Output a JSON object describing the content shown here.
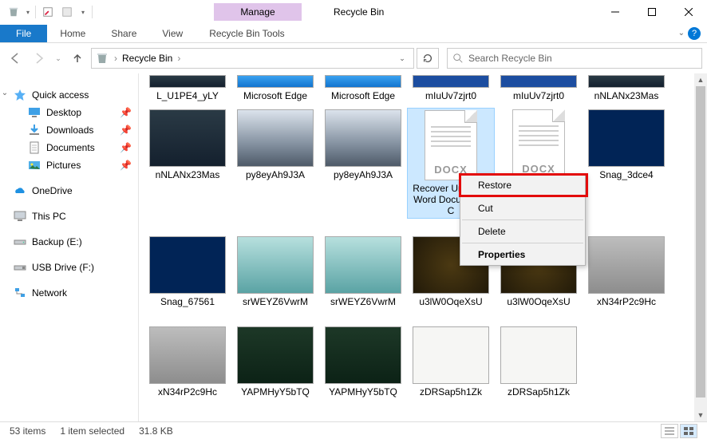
{
  "window": {
    "title": "Recycle Bin",
    "context_tab_group": "Manage",
    "tabs": {
      "file": "File",
      "home": "Home",
      "share": "Share",
      "view": "View",
      "tools": "Recycle Bin Tools"
    }
  },
  "address": {
    "location": "Recycle Bin",
    "separator": "›"
  },
  "search": {
    "placeholder": "Search Recycle Bin"
  },
  "sidebar": {
    "quick_access": "Quick access",
    "desktop": "Desktop",
    "downloads": "Downloads",
    "documents": "Documents",
    "pictures": "Pictures",
    "onedrive": "OneDrive",
    "this_pc": "This PC",
    "backup": "Backup (E:)",
    "usb": "USB Drive (F:)",
    "network": "Network"
  },
  "files": {
    "row1": [
      {
        "name": "L_U1PE4_yLY",
        "kind": "dark"
      },
      {
        "name": "Microsoft Edge",
        "kind": "edge"
      },
      {
        "name": "Microsoft Edge",
        "kind": "edge"
      },
      {
        "name": "mIuUv7zjrt0",
        "kind": "blue"
      },
      {
        "name": "mIuUv7zjrt0",
        "kind": "blue"
      },
      {
        "name": "nNLANx23Mas",
        "kind": "dark"
      }
    ],
    "row2": [
      {
        "name": "nNLANx23Mas",
        "kind": "dark"
      },
      {
        "name": "py8eyAh9J3A",
        "kind": "city"
      },
      {
        "name": "py8eyAh9J3A",
        "kind": "city"
      },
      {
        "name": "Recover Unsaved Word Document - C",
        "kind": "docx",
        "selected": true
      },
      {
        "name": "",
        "kind": "docx"
      },
      {
        "name": "Snag_3dce4",
        "kind": "ps"
      }
    ],
    "row3": [
      {
        "name": "Snag_67561",
        "kind": "ps"
      },
      {
        "name": "srWEYZ6VwrM",
        "kind": "teal"
      },
      {
        "name": "srWEYZ6VwrM",
        "kind": "teal"
      },
      {
        "name": "u3lW0OqeXsU",
        "kind": "gold"
      },
      {
        "name": "u3lW0OqeXsU",
        "kind": "gold"
      },
      {
        "name": "xN34rP2c9Hc",
        "kind": "gray"
      }
    ],
    "row4": [
      {
        "name": "xN34rP2c9Hc",
        "kind": "gray"
      },
      {
        "name": "YAPMHyY5bTQ",
        "kind": "green"
      },
      {
        "name": "YAPMHyY5bTQ",
        "kind": "green"
      },
      {
        "name": "zDRSap5h1Zk",
        "kind": "white"
      },
      {
        "name": "zDRSap5h1Zk",
        "kind": "white"
      }
    ]
  },
  "doc_label": "DOCX",
  "context_menu": {
    "restore": "Restore",
    "cut": "Cut",
    "delete": "Delete",
    "properties": "Properties"
  },
  "status": {
    "total": "53 items",
    "selected": "1 item selected",
    "size": "31.8 KB"
  }
}
